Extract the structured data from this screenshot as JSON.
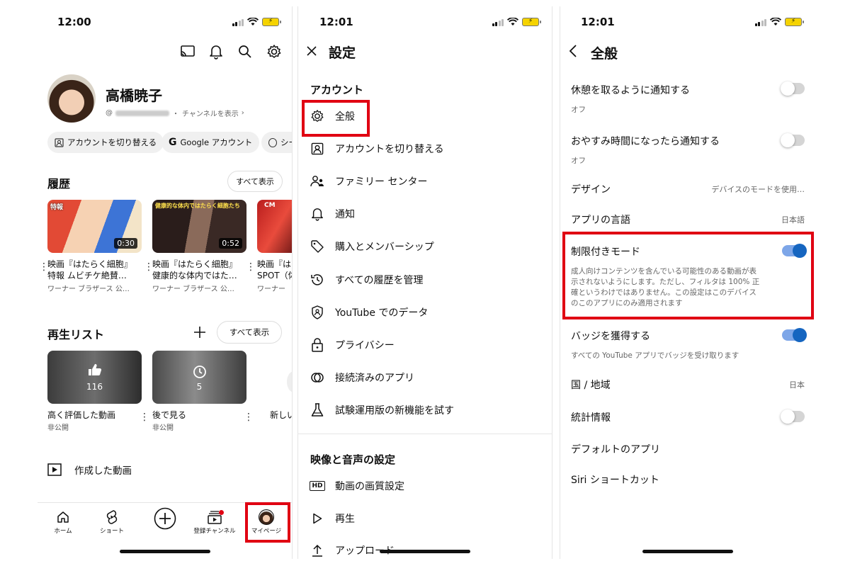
{
  "panel1": {
    "time": "12:00",
    "profile": {
      "name": "高橋暁子",
      "handle": "@",
      "view_channel": "チャンネルを表示"
    },
    "chips": [
      "アカウントを切り替える",
      "Google アカウント",
      "シー"
    ],
    "history": {
      "title": "履歴",
      "view_all": "すべて表示",
      "videos": [
        {
          "badge": "特報",
          "duration": "0:30",
          "title1": "映画『はたらく細胞』",
          "title2": "特報 ムビチケ絶賛…",
          "channel": "ワーナー ブラザース 公…",
          "colors": [
            "#d93b2b",
            "#f5c8a0",
            "#3c6ed1"
          ]
        },
        {
          "badge": "健康的な体内ではたらく細胞たち",
          "duration": "0:52",
          "title1": "映画『はたらく細胞』",
          "title2": "健康的な体内ではた…",
          "channel": "ワーナー ブラザース 公…",
          "colors": [
            "#3a2a28",
            "#7a5b4d",
            "#2b1d1a"
          ]
        },
        {
          "badge": "CM",
          "duration": "",
          "title1": "映画『はた",
          "title2": "SPOT（体",
          "channel": "ワーナー",
          "colors": [
            "#b01c1c",
            "#e94b3c",
            "#5d1010"
          ]
        }
      ]
    },
    "playlists": {
      "title": "再生リスト",
      "view_all": "すべて表示",
      "items": [
        {
          "title": "高く評価した動画",
          "status": "非公開",
          "count": "116"
        },
        {
          "title": "後で見る",
          "status": "非公開",
          "count": "5"
        },
        {
          "title": "新しい",
          "status": "",
          "count": ""
        }
      ]
    },
    "created_videos": "作成した動画",
    "nav": {
      "home": "ホーム",
      "shorts": "ショート",
      "subscriptions": "登録チャンネル",
      "mypage": "マイページ"
    }
  },
  "panel2": {
    "time": "12:01",
    "title": "設定",
    "account_section": "アカウント",
    "items": [
      "全般",
      "アカウントを切り替える",
      "ファミリー センター",
      "通知",
      "購入とメンバーシップ",
      "すべての履歴を管理",
      "YouTube でのデータ",
      "プライバシー",
      "接続済みのアプリ",
      "試験運用版の新機能を試す"
    ],
    "video_section": "映像と音声の設定",
    "video_items": [
      "動画の画質設定",
      "再生",
      "アップロード"
    ]
  },
  "panel3": {
    "time": "12:01",
    "title": "全般",
    "rows": {
      "break_reminder": {
        "label": "休憩を取るように通知する",
        "sub": "オフ"
      },
      "bedtime_reminder": {
        "label": "おやすみ時間になったら通知する",
        "sub": "オフ"
      },
      "design": {
        "label": "デザイン",
        "value": "デバイスのモードを使用…"
      },
      "app_language": {
        "label": "アプリの言語",
        "value": "日本語"
      },
      "restricted_mode": {
        "label": "制限付きモード",
        "desc1": "成人向けコンテンツを含んでいる可能性のある動画が表",
        "desc2": "示されないようにします。ただし、フィルタは 100% 正",
        "desc3": "確というわけではありません。この設定はこのデバイス",
        "desc4": "のこのアプリにのみ適用されます"
      },
      "badges": {
        "label": "バッジを獲得する",
        "sub": "すべての YouTube アプリでバッジを受け取ります"
      },
      "country": {
        "label": "国 / 地域",
        "value": "日本"
      },
      "stats": {
        "label": "統計情報"
      },
      "default_apps": {
        "label": "デフォルトのアプリ"
      },
      "siri": {
        "label": "Siri ショートカット"
      }
    }
  },
  "colors": {
    "highlight": "#e00012",
    "toggle_on": "#1565c0",
    "notif_dot": "#e00012"
  }
}
